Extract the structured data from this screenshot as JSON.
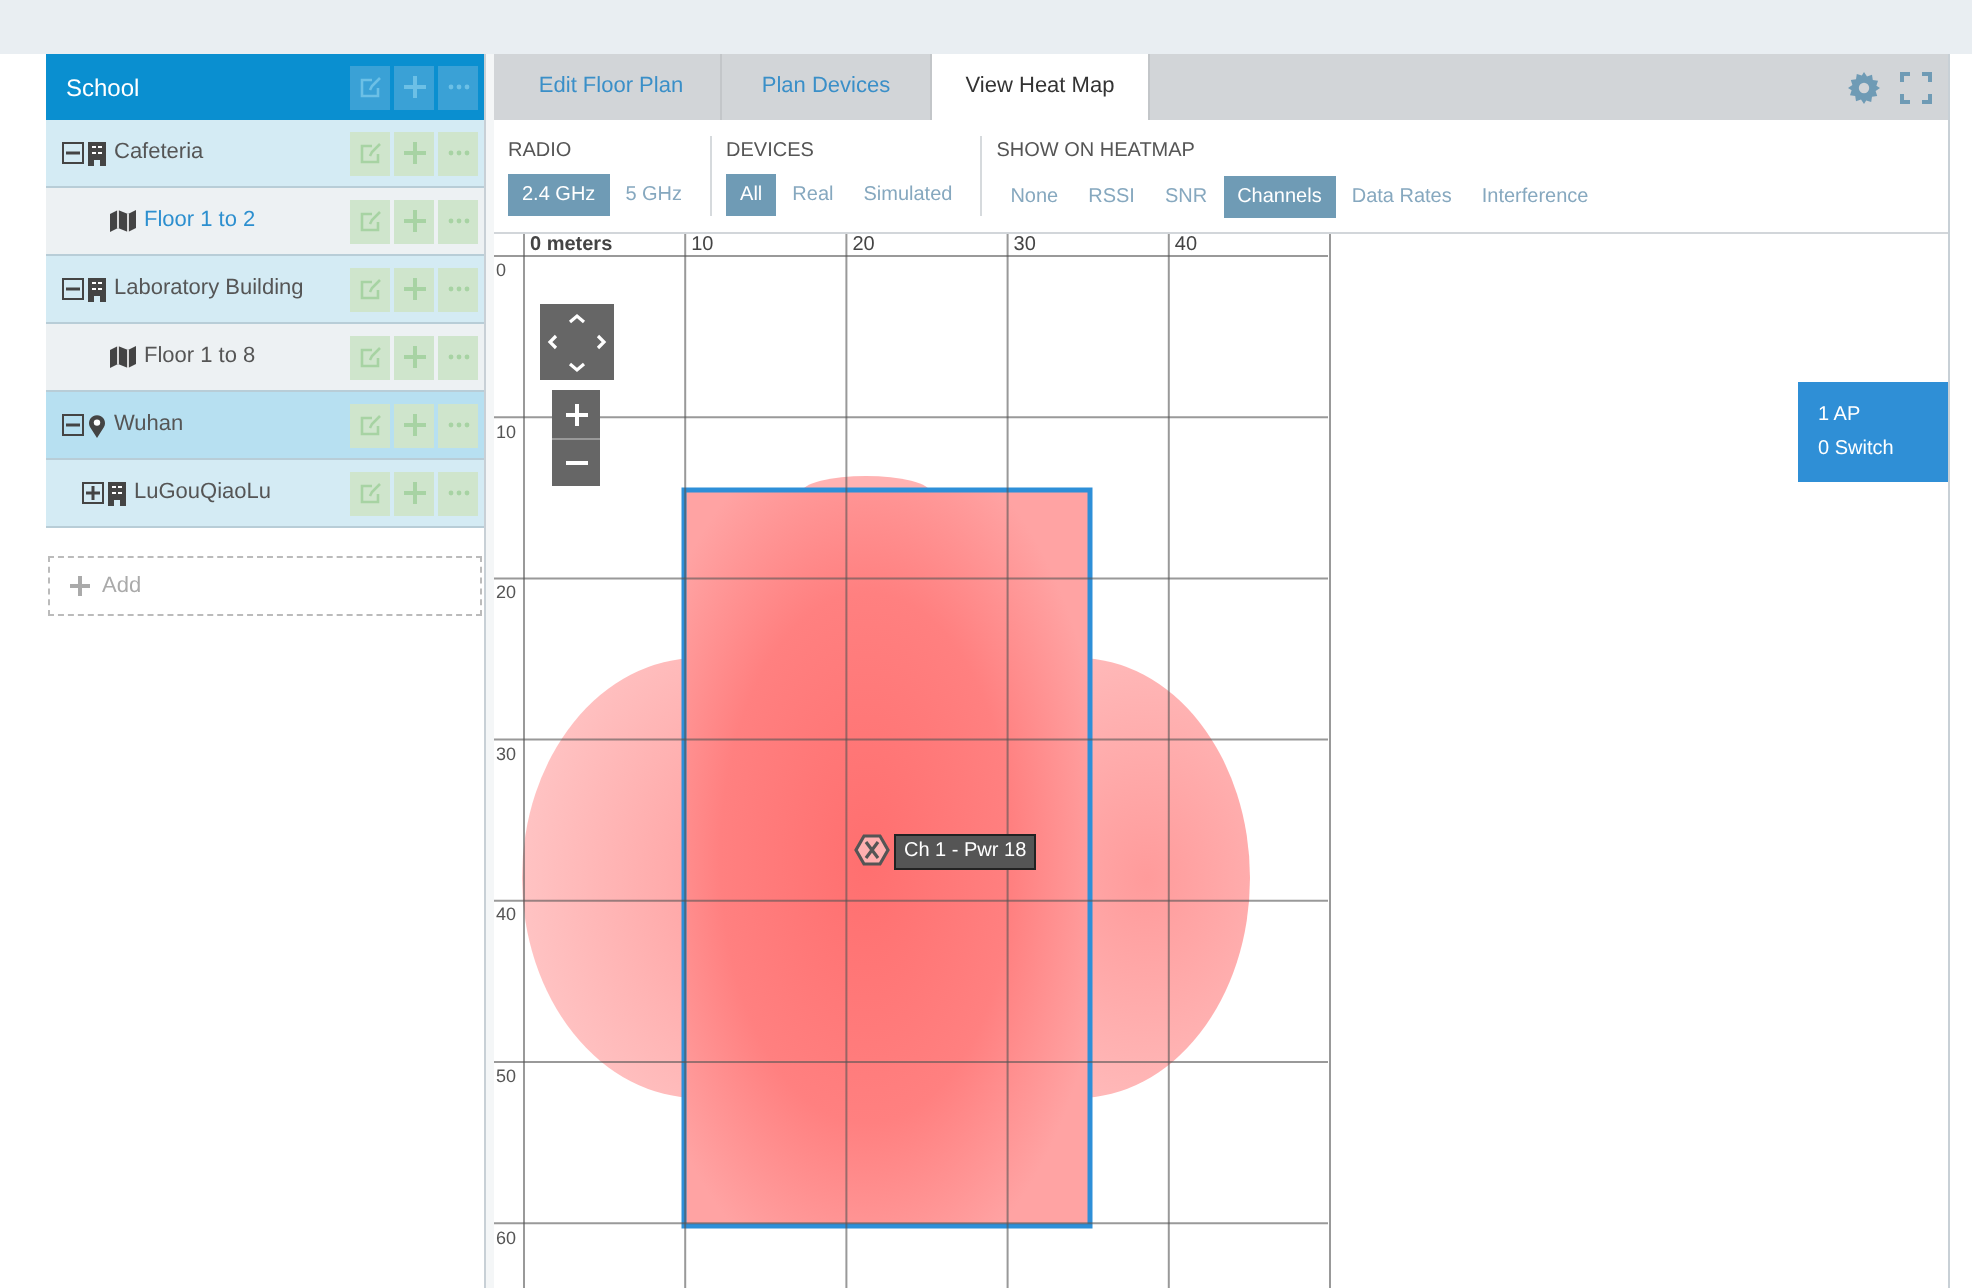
{
  "sidebar": {
    "title": "School",
    "tree": [
      {
        "label": "Cafeteria",
        "kind": "building",
        "expanded": true,
        "selected": false,
        "highlighted": false,
        "children": [
          {
            "label": "Floor 1 to 2",
            "kind": "floor",
            "selected": true,
            "highlighted": false
          }
        ]
      },
      {
        "label": "Laboratory Building",
        "kind": "building",
        "expanded": true,
        "selected": false,
        "highlighted": false,
        "children": [
          {
            "label": "Floor 1 to 8",
            "kind": "floor",
            "selected": false,
            "highlighted": false
          }
        ]
      },
      {
        "label": "Wuhan",
        "kind": "location",
        "expanded": true,
        "selected": false,
        "highlighted": true,
        "children": [
          {
            "label": "LuGouQiaoLu",
            "kind": "building",
            "expanded": false,
            "selected": false,
            "highlighted": false
          }
        ]
      }
    ],
    "add_label": "Add"
  },
  "tabs": [
    {
      "label": "Edit Floor Plan",
      "selected": false
    },
    {
      "label": "Plan Devices",
      "selected": false
    },
    {
      "label": "View Heat Map",
      "selected": true
    }
  ],
  "filters": [
    {
      "label": "RADIO",
      "options": [
        {
          "label": "2.4 GHz",
          "selected": true
        },
        {
          "label": "5 GHz",
          "selected": false
        }
      ]
    },
    {
      "label": "DEVICES",
      "options": [
        {
          "label": "All",
          "selected": true
        },
        {
          "label": "Real",
          "selected": false
        },
        {
          "label": "Simulated",
          "selected": false
        }
      ]
    },
    {
      "label": "SHOW ON HEATMAP",
      "options": [
        {
          "label": "None",
          "selected": false
        },
        {
          "label": "RSSI",
          "selected": false
        },
        {
          "label": "SNR",
          "selected": false
        },
        {
          "label": "Channels",
          "selected": true
        },
        {
          "label": "Data Rates",
          "selected": false
        },
        {
          "label": "Interference",
          "selected": false
        }
      ]
    }
  ],
  "map": {
    "x_labels": [
      "0 meters",
      "10",
      "20",
      "30",
      "40"
    ],
    "y_labels": [
      "0",
      "10",
      "20",
      "30",
      "40",
      "50",
      "60"
    ],
    "access_point": {
      "label": "Ch 1 - Pwr 18"
    },
    "summary": [
      "1 AP",
      "0 Switch"
    ]
  }
}
